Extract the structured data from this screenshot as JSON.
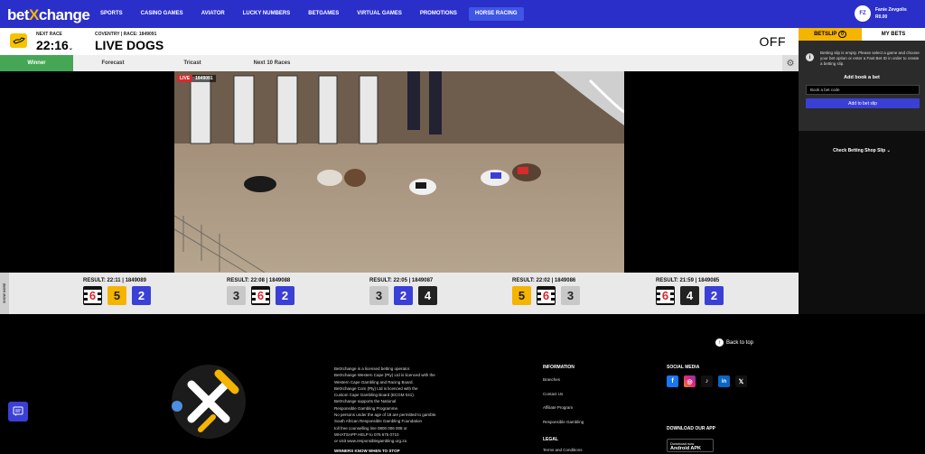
{
  "brand": {
    "logo_left": "bet",
    "logo_x": "X",
    "logo_right": "change"
  },
  "nav": [
    {
      "label": "SPORTS"
    },
    {
      "label": "CASINO GAMES"
    },
    {
      "label": "AVIATOR"
    },
    {
      "label": "LUCKY NUMBERS"
    },
    {
      "label": "BETGAMES"
    },
    {
      "label": "VIRTUAL GAMES"
    },
    {
      "label": "PROMOTIONS"
    },
    {
      "label": "HORSE RACING"
    }
  ],
  "user": {
    "initials": "FZ",
    "name": "Fanie Zevgolis",
    "balance": "R0.00"
  },
  "race": {
    "next_label": "NEXT RACE",
    "time": "22:16",
    "info": "COVENTRY | RACE: 1849091",
    "title": "LIVE DOGS",
    "status": "OFF"
  },
  "tabs": [
    "Winner",
    "Forecast",
    "Tricast",
    "Next 10 Races"
  ],
  "video": {
    "live": "LIVE",
    "id": "1849091"
  },
  "side_tab": "SHOW MORE",
  "results": [
    {
      "label": "RESULT: 22:11 | 1849089",
      "traps": [
        6,
        5,
        2
      ]
    },
    {
      "label": "RESULT: 22:08 | 1849088",
      "traps": [
        3,
        6,
        2
      ]
    },
    {
      "label": "RESULT: 22:05 | 1849087",
      "traps": [
        3,
        2,
        4
      ]
    },
    {
      "label": "RESULT: 22:02 | 1849086",
      "traps": [
        5,
        6,
        3
      ]
    },
    {
      "label": "RESULT: 21:59 | 1849085",
      "traps": [
        6,
        4,
        2
      ]
    }
  ],
  "betslip": {
    "tab_betslip": "BETSLIP",
    "betslip_count": "0",
    "tab_mybets": "MY BETS",
    "empty_msg": "Betting slip is empty. Please select a game and choose your bet option or enter a Fast Bet ID in order to create a betting slip.",
    "add_title": "Add book a bet",
    "input_placeholder": "Book a bet code",
    "add_button": "Add to bet slip",
    "check_shop": "Check Betting Shop Slip"
  },
  "footer": {
    "back_to_top": "Back to top",
    "legal_lines": [
      "BetXchange is a licensed betting operator.",
      "BetXchange Western Cape (Pty) Ltd is licenced with the",
      "Western Cape Gambling and Racing Board.",
      "BetXchange Com (Pty) Ltd is licenced with the",
      "Custom Cape Gambling Board (ECGM 041).",
      "BetXchange supports the National",
      "Responsible Gambling Programme.",
      "No persons under the age of 18 are permitted to gamble.",
      "South African Responsible Gambling Foundation",
      "toll free counselling line 0800 006 008 or",
      "WHATSAPP HELP to 076 675 0710",
      "or visit www.responsiblegambling.org.za"
    ],
    "legal_strong": "WINNERS KNOW WHEN TO STOP",
    "info_title": "INFORMATION",
    "info_links": [
      "Branches",
      "Contact Us",
      "Affiliate Program",
      "Responsible Gambling"
    ],
    "legal_title": "LEGAL",
    "legal_link": "Terms and Conditions",
    "social_title": "SOCIAL MEDIA",
    "socials": [
      "f",
      "ig",
      "tt",
      "in",
      "X"
    ],
    "app_title": "DOWNLOAD OUR APP",
    "android_small": "Download now",
    "android_big": "Android APK"
  },
  "colors": {
    "primary": "#2a2fc9",
    "accent": "#f5b400",
    "green": "#45a756"
  }
}
